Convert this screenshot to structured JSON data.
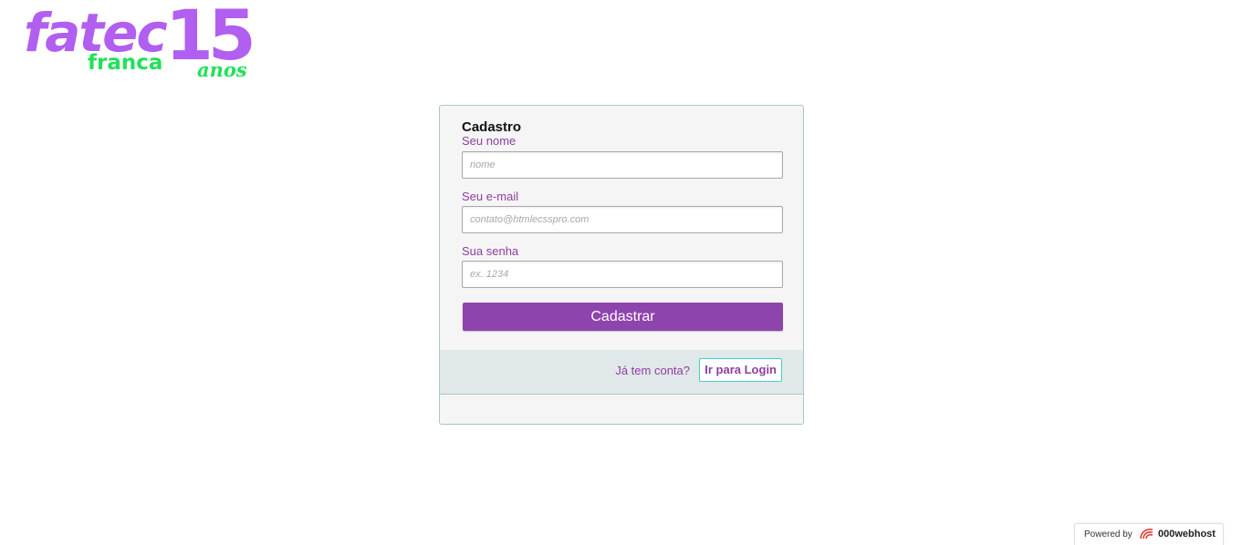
{
  "logo": {
    "brand": "fatec",
    "city": "franca",
    "number": "15",
    "suffix": "anos"
  },
  "form": {
    "title": "Cadastro",
    "fields": [
      {
        "label": "Seu nome",
        "placeholder": "nome"
      },
      {
        "label": "Seu e-mail",
        "placeholder": "contato@htmlecsspro.com"
      },
      {
        "label": "Sua senha",
        "placeholder": "ex. 1234"
      }
    ],
    "submit_label": "Cadastrar"
  },
  "footer": {
    "prompt": "Já tem conta?",
    "login_label": "Ir para Login"
  },
  "badge": {
    "powered_by": "Powered by",
    "brand": "000webhost"
  },
  "colors": {
    "accent": "#8e44ad",
    "logo_purple": "#b15ff0",
    "logo_green": "#22e05a",
    "login_border": "#3fd3c4"
  }
}
